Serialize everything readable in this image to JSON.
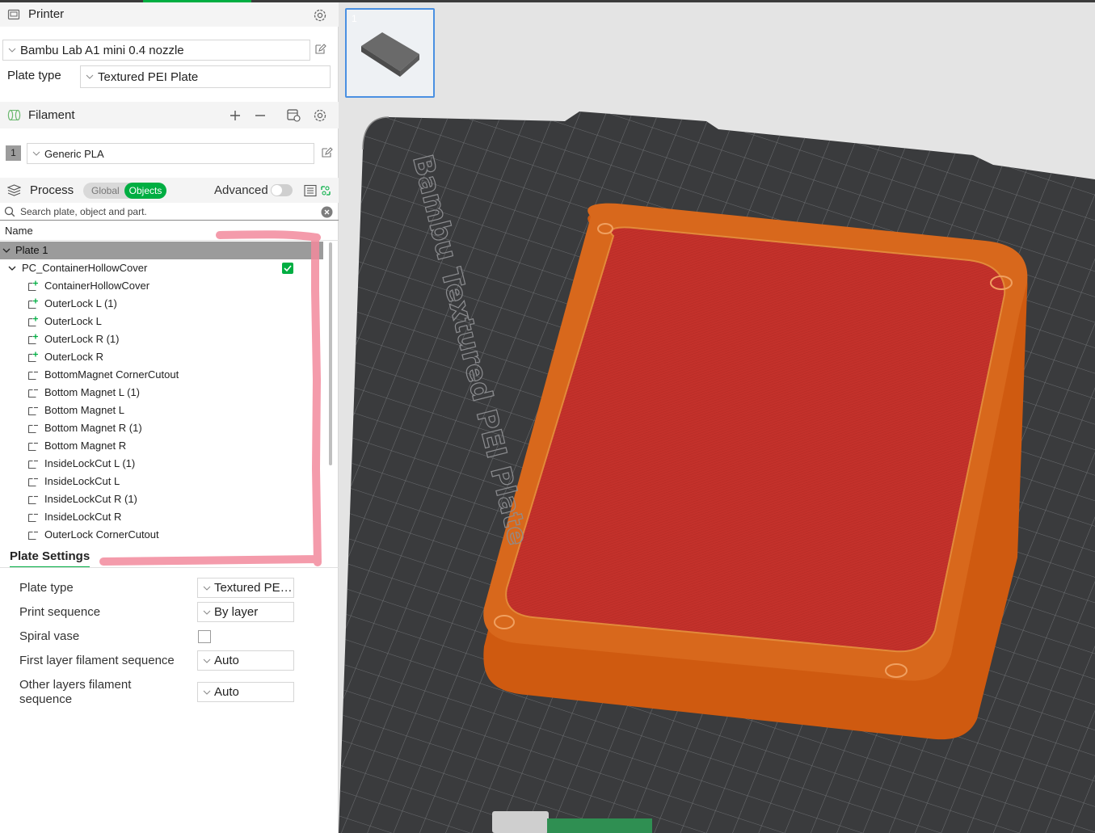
{
  "printer": {
    "section_title": "Printer",
    "preset": "Bambu Lab A1 mini 0.4 nozzle",
    "plate_type_label": "Plate type",
    "plate_type_value": "Textured PEI Plate"
  },
  "filament": {
    "section_title": "Filament",
    "slot_number": "1",
    "preset": "Generic PLA"
  },
  "process": {
    "section_title": "Process",
    "toggle_global": "Global",
    "toggle_objects": "Objects",
    "advanced_label": "Advanced",
    "search_placeholder": "Search plate, object and part."
  },
  "tree": {
    "column_name": "Name",
    "plate": "Plate 1",
    "object": "PC_ContainerHollowCover",
    "parts": [
      "ContainerHollowCover",
      "OuterLock L (1)",
      "OuterLock L",
      "OuterLock R (1)",
      "OuterLock R",
      "BottomMagnet CornerCutout",
      "Bottom Magnet L (1)",
      "Bottom Magnet L",
      "Bottom Magnet R (1)",
      "Bottom Magnet R",
      "InsideLockCut L (1)",
      "InsideLockCut L",
      "InsideLockCut R (1)",
      "InsideLockCut R",
      "OuterLock CornerCutout"
    ]
  },
  "plate_settings": {
    "tab": "Plate Settings",
    "plate_type_label": "Plate type",
    "plate_type_value": "Textured PEI...",
    "print_sequence_label": "Print sequence",
    "print_sequence_value": "By layer",
    "spiral_vase_label": "Spiral vase",
    "first_layer_label": "First layer filament sequence",
    "first_layer_value": "Auto",
    "other_layers_label_1": "Other layers filament",
    "other_layers_label_2": "sequence",
    "other_layers_value": "Auto"
  },
  "viewport": {
    "plate_thumb_number": "1",
    "bed_label": "Bambu Textured PEI Plate"
  },
  "colors": {
    "accent_green": "#00ae42",
    "object_red": "#c2302a",
    "object_orange": "#d86212",
    "bed": "#3a3b3d",
    "annotation_pink": "#f28a9c"
  }
}
